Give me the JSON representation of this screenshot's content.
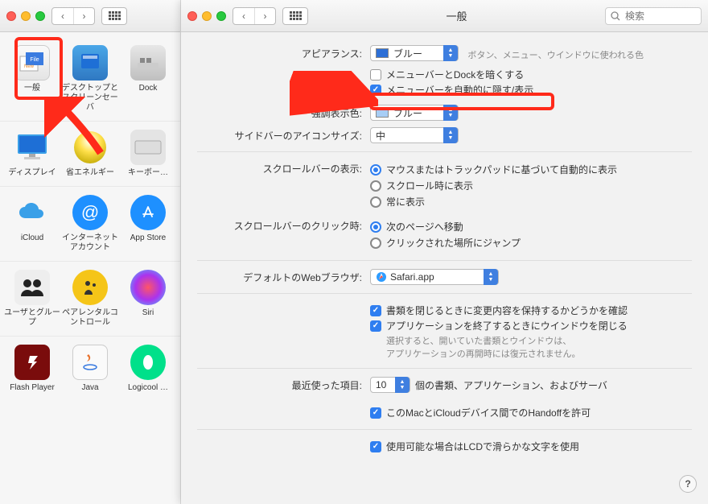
{
  "left": {
    "items": [
      [
        "一般",
        "デスクトップとスクリーンセーバ",
        "Dock"
      ],
      [
        "ディスプレイ",
        "省エネルギー",
        "キーボー…"
      ],
      [
        "iCloud",
        "インターネットアカウント",
        "App Store"
      ],
      [
        "ユーザとグループ",
        "ペアレンタルコントロール",
        "Siri"
      ],
      [
        "Flash Player",
        "Java",
        "Logicool …"
      ]
    ]
  },
  "right": {
    "title": "一般",
    "search_placeholder": "検索",
    "labels": {
      "appearance": "アピアランス:",
      "highlight": "強調表示色:",
      "sidebar": "サイドバーのアイコンサイズ:",
      "scrollbar_show": "スクロールバーの表示:",
      "scrollbar_click": "スクロールバーのクリック時:",
      "default_browser": "デフォルトのWebブラウザ:",
      "recent": "最近使った項目:"
    },
    "appearance_value": "ブルー",
    "appearance_hint": "ボタン、メニュー、ウインドウに使われる色",
    "darken_label": "メニューバーとDockを暗くする",
    "autohide_label": "メニューバーを自動的に隠す/表示",
    "highlight_value": "ブルー",
    "sidebar_value": "中",
    "scrollbar_show_opts": [
      "マウスまたはトラックパッドに基づいて自動的に表示",
      "スクロール時に表示",
      "常に表示"
    ],
    "scrollbar_click_opts": [
      "次のページへ移動",
      "クリックされた場所にジャンプ"
    ],
    "default_browser_value": "Safari.app",
    "close_confirm_label": "書類を閉じるときに変更内容を保持するかどうかを確認",
    "close_windows_label": "アプリケーションを終了するときにウインドウを閉じる",
    "close_windows_hint1": "選択すると、開いていた書類とウインドウは、",
    "close_windows_hint2": "アプリケーションの再開時には復元されません。",
    "recent_value": "10",
    "recent_suffix": "個の書類、アプリケーション、およびサーバ",
    "handoff_label": "このMacとiCloudデバイス間でのHandoffを許可",
    "lcd_label": "使用可能な場合はLCDで滑らかな文字を使用"
  }
}
